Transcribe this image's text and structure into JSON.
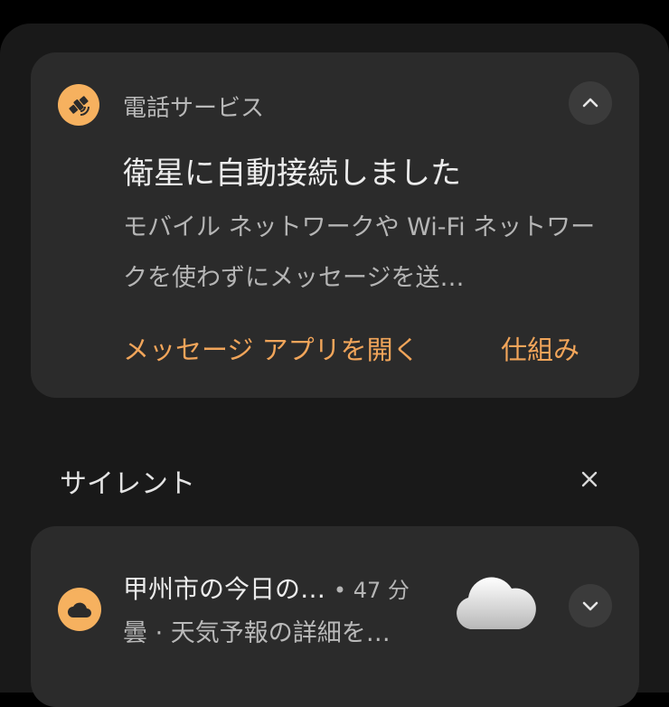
{
  "notification1": {
    "app_name": "電話サービス",
    "title": "衛星に自動接続しました",
    "body": "モバイル ネットワークや Wi-Fi ネットワークを使わずにメッセージを送…",
    "actions": [
      "メッセージ アプリを開く",
      "仕組み"
    ],
    "icon": "satellite-icon",
    "accent_color": "#f6b15f"
  },
  "silent_section": {
    "title": "サイレント"
  },
  "notification2": {
    "title": "甲州市の今日の…",
    "time": "• 47 分",
    "body": "曇 · 天気予報の詳細を…",
    "icon": "cloud-icon"
  }
}
